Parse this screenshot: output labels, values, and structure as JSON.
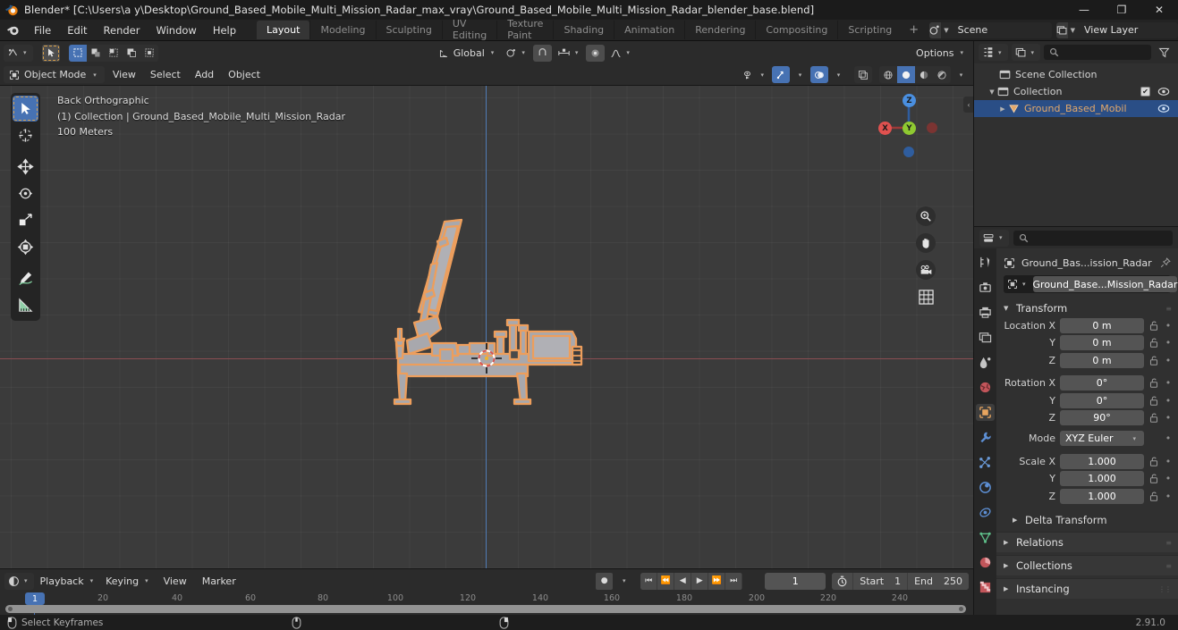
{
  "window": {
    "title": "Blender* [C:\\Users\\a y\\Desktop\\Ground_Based_Mobile_Multi_Mission_Radar_max_vray\\Ground_Based_Mobile_Multi_Mission_Radar_blender_base.blend]",
    "minimize": "—",
    "maximize": "❐",
    "close": "✕"
  },
  "topbar": {
    "menus": [
      "File",
      "Edit",
      "Render",
      "Window",
      "Help"
    ],
    "workspaces": [
      {
        "label": "Layout",
        "active": true
      },
      {
        "label": "Modeling",
        "active": false
      },
      {
        "label": "Sculpting",
        "active": false
      },
      {
        "label": "UV Editing",
        "active": false
      },
      {
        "label": "Texture Paint",
        "active": false
      },
      {
        "label": "Shading",
        "active": false
      },
      {
        "label": "Animation",
        "active": false
      },
      {
        "label": "Rendering",
        "active": false
      },
      {
        "label": "Compositing",
        "active": false
      },
      {
        "label": "Scripting",
        "active": false
      }
    ],
    "add_workspace": "+",
    "scene": {
      "name": "Scene",
      "new_btn": "⧉",
      "unlink_btn": "✕"
    },
    "view_layer": {
      "name": "View Layer",
      "new_btn": "⧉",
      "unlink_btn": "✕"
    }
  },
  "viewport": {
    "header_row1": {
      "editor_type": "editor-type-3dview",
      "transform_orientation": "Global",
      "options_label": "Options"
    },
    "header_row2": {
      "mode": "Object Mode",
      "menus": [
        "View",
        "Select",
        "Add",
        "Object"
      ]
    },
    "overlay_text": {
      "view_name": "Back Orthographic",
      "collection_object": "(1) Collection | Ground_Based_Mobile_Multi_Mission_Radar",
      "grid_scale": "100 Meters"
    },
    "gizmo_axes": [
      {
        "label": "Z",
        "color": "#4a8fe0"
      },
      {
        "label": "Y",
        "color": "#8fc931"
      },
      {
        "label": "X",
        "color": "#e0514f"
      }
    ],
    "tools": [
      "tweak-select-box-tool",
      "cursor-tool",
      "move-tool",
      "rotate-tool",
      "scale-tool",
      "transform-tool",
      "annotate-tool",
      "measure-tool"
    ],
    "nav_buttons": [
      "zoom-icon",
      "pan-hand-icon",
      "camera-icon",
      "grid-ortho-icon"
    ]
  },
  "outliner": {
    "search_placeholder": "",
    "rows": [
      {
        "label": "Scene Collection",
        "type": "scene-collection",
        "depth": 0,
        "disclosure": "",
        "selected": false,
        "checkbox": false,
        "eye": false
      },
      {
        "label": "Collection",
        "type": "collection",
        "depth": 1,
        "disclosure": "▼",
        "selected": false,
        "checkbox": true,
        "eye": true
      },
      {
        "label": "Ground_Based_Mobil",
        "type": "object",
        "depth": 2,
        "disclosure": "▶",
        "selected": true,
        "checkbox": false,
        "eye": true
      }
    ],
    "checkbox_mark": "✔"
  },
  "properties": {
    "search_placeholder": "",
    "breadcrumb": "Ground_Bas...ission_Radar",
    "object_name": "Ground_Base...Mission_Radar",
    "panels": [
      {
        "title": "Transform",
        "open": true
      },
      {
        "title": "Delta Transform",
        "open": false,
        "sub": true
      },
      {
        "title": "Relations",
        "open": false
      },
      {
        "title": "Collections",
        "open": false
      },
      {
        "title": "Instancing",
        "open": false
      }
    ],
    "transform": {
      "location": {
        "label": "Location X",
        "x": "0 m",
        "y": "0 m",
        "z": "0 m",
        "y_label": "Y",
        "z_label": "Z"
      },
      "rotation": {
        "label": "Rotation X",
        "x": "0°",
        "y": "0°",
        "z": "90°",
        "y_label": "Y",
        "z_label": "Z"
      },
      "mode": {
        "label": "Mode",
        "value": "XYZ Euler"
      },
      "scale": {
        "label": "Scale X",
        "x": "1.000",
        "y": "1.000",
        "z": "1.000",
        "y_label": "Y",
        "z_label": "Z"
      }
    },
    "tabs": [
      "tool-icon",
      "render-icon",
      "output-icon",
      "view-layer-icon",
      "scene-icon",
      "world-icon",
      "object-icon",
      "modifier-icon",
      "particles-icon",
      "physics-icon",
      "constraints-icon",
      "data-icon",
      "material-icon",
      "texture-icon"
    ]
  },
  "timeline": {
    "editor_type": "editor-type-timeline",
    "menus": [
      "Playback",
      "Keying",
      "View",
      "Marker"
    ],
    "current_frame": "1",
    "start_label": "Start",
    "start_value": "1",
    "end_label": "End",
    "end_value": "250",
    "playhead_frame": "1",
    "ticks": [
      "20",
      "40",
      "60",
      "80",
      "100",
      "120",
      "140",
      "160",
      "180",
      "200",
      "220",
      "240"
    ]
  },
  "statusbar": {
    "hint": "Select Keyframes",
    "version": "2.91.0"
  },
  "colors": {
    "accent_blue": "#4772b3",
    "selected_orange": "#ed9e5c",
    "panel_bg": "#303030",
    "viewport_bg": "#3b3b3b"
  }
}
